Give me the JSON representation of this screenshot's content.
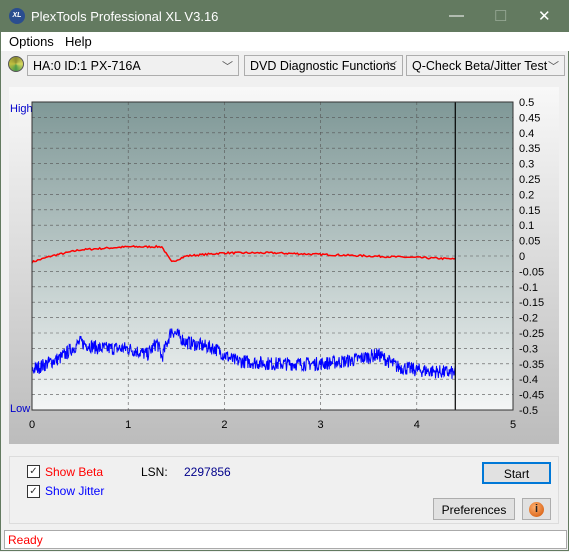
{
  "window": {
    "title": "PlexTools Professional XL V3.16",
    "logo_text": "XL"
  },
  "menu": [
    "Options",
    "Help"
  ],
  "toolbar": {
    "drive": "HA:0 ID:1  PX-716A",
    "function": "DVD Diagnostic Functions",
    "test": "Q-Check Beta/Jitter Test"
  },
  "chart_data": {
    "type": "line",
    "y_top_label": "High",
    "y_bottom_label": "Low",
    "xlim": [
      0,
      5
    ],
    "ylim": [
      -0.5,
      0.5
    ],
    "x_ticks": [
      "0",
      "1",
      "2",
      "3",
      "4",
      "5"
    ],
    "y_ticks": [
      "0.5",
      "0.45",
      "0.4",
      "0.35",
      "0.3",
      "0.25",
      "0.2",
      "0.15",
      "0.1",
      "0.05",
      "0",
      "-0.05",
      "-0.1",
      "-0.15",
      "-0.2",
      "-0.25",
      "-0.3",
      "-0.35",
      "-0.4",
      "-0.45",
      "-0.5"
    ],
    "grid": true,
    "end_marker_x": 4.4,
    "series": [
      {
        "name": "Beta",
        "color": "#ff0000",
        "x": [
          0,
          0.2,
          0.5,
          1.0,
          1.35,
          1.45,
          1.6,
          2.0,
          2.5,
          3.0,
          3.5,
          4.0,
          4.4
        ],
        "y": [
          -0.02,
          0.0,
          0.02,
          0.03,
          0.03,
          -0.02,
          0.0,
          0.01,
          0.01,
          0.005,
          0.0,
          -0.005,
          -0.01
        ]
      },
      {
        "name": "Jitter",
        "color": "#0000ff",
        "x": [
          0,
          0.3,
          0.5,
          0.7,
          1.0,
          1.2,
          1.3,
          1.35,
          1.45,
          1.6,
          1.9,
          2.1,
          2.5,
          3.0,
          3.3,
          3.6,
          3.8,
          4.0,
          4.4
        ],
        "y": [
          -0.37,
          -0.33,
          -0.28,
          -0.3,
          -0.3,
          -0.32,
          -0.28,
          -0.33,
          -0.24,
          -0.28,
          -0.3,
          -0.34,
          -0.35,
          -0.35,
          -0.34,
          -0.32,
          -0.36,
          -0.37,
          -0.38
        ]
      }
    ]
  },
  "controls": {
    "show_beta": "Show Beta",
    "show_jitter": "Show Jitter",
    "show_beta_checked": true,
    "show_jitter_checked": true,
    "lsn_label": "LSN:",
    "lsn_value": "2297856",
    "start": "Start",
    "preferences": "Preferences"
  },
  "status": "Ready"
}
